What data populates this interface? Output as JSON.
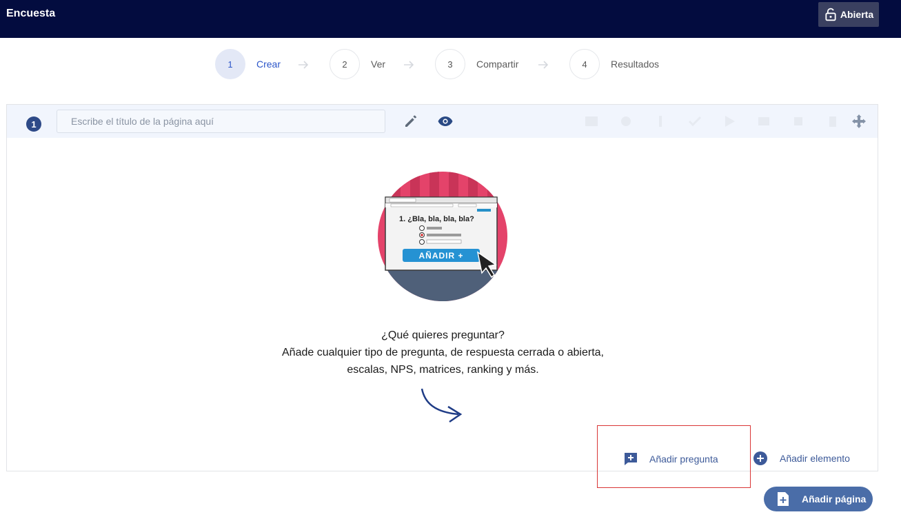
{
  "app": {
    "title": "Encuesta",
    "status_label": "Abierta",
    "status_icon": "unlock-icon"
  },
  "steps": [
    {
      "number": "1",
      "label": "Crear",
      "active": true
    },
    {
      "number": "2",
      "label": "Ver",
      "active": false
    },
    {
      "number": "3",
      "label": "Compartir",
      "active": false
    },
    {
      "number": "4",
      "label": "Resultados",
      "active": false
    }
  ],
  "page": {
    "number": "1",
    "title_value": "",
    "title_placeholder": "Escribe el título de la página aquí"
  },
  "illustration": {
    "question_text": "1. ¿Bla, bla, bla, bla?",
    "button_text": "AÑADIR +"
  },
  "prompt": {
    "line1": "¿Qué quieres preguntar?",
    "line2": "Añade cualquier tipo de pregunta, de respuesta cerrada o abierta,",
    "line3": "escalas, NPS, matrices, ranking y más."
  },
  "actions": {
    "add_question": "Añadir pregunta",
    "add_element": "Añadir elemento",
    "add_page": "Añadir página"
  },
  "colors": {
    "topbar": "#030c3f",
    "accent": "#2c56c9",
    "action": "#3d5a99",
    "highlight": "#d93535"
  }
}
